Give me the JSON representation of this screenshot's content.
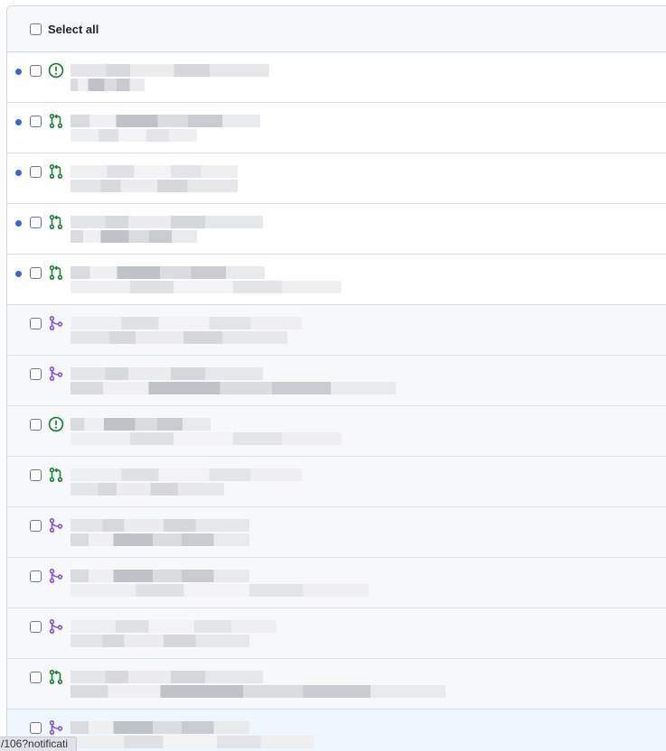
{
  "header": {
    "select_all_label": "Select all"
  },
  "colors": {
    "unread_dot": "#2f6bd6",
    "issue_open": "#1a7f37",
    "pr_open": "#1a7f37",
    "pr_merged": "#8250df",
    "row_read_bg": "#f6f8fa",
    "row_hover_bg": "#eef6ff"
  },
  "notifications": [
    {
      "type": "issue-open",
      "icon": "issue-opened-icon",
      "unread": true
    },
    {
      "type": "pr-open",
      "icon": "git-pull-request-icon",
      "unread": true
    },
    {
      "type": "pr-open",
      "icon": "git-pull-request-icon",
      "unread": true
    },
    {
      "type": "pr-open",
      "icon": "git-pull-request-icon",
      "unread": true
    },
    {
      "type": "pr-open",
      "icon": "git-pull-request-icon",
      "unread": true
    },
    {
      "type": "pr-merged",
      "icon": "git-merge-icon",
      "unread": false
    },
    {
      "type": "pr-merged",
      "icon": "git-merge-icon",
      "unread": false
    },
    {
      "type": "issue-open",
      "icon": "issue-opened-icon",
      "unread": false
    },
    {
      "type": "pr-open",
      "icon": "git-pull-request-icon",
      "unread": false
    },
    {
      "type": "pr-merged",
      "icon": "git-merge-icon",
      "unread": false
    },
    {
      "type": "pr-merged",
      "icon": "git-merge-icon",
      "unread": false
    },
    {
      "type": "pr-merged",
      "icon": "git-merge-icon",
      "unread": false
    },
    {
      "type": "pr-open",
      "icon": "git-pull-request-icon",
      "unread": false
    },
    {
      "type": "pr-merged",
      "icon": "git-merge-icon",
      "unread": false,
      "hovered": true
    }
  ],
  "status_bar": {
    "url_text": "/106?notificati"
  }
}
